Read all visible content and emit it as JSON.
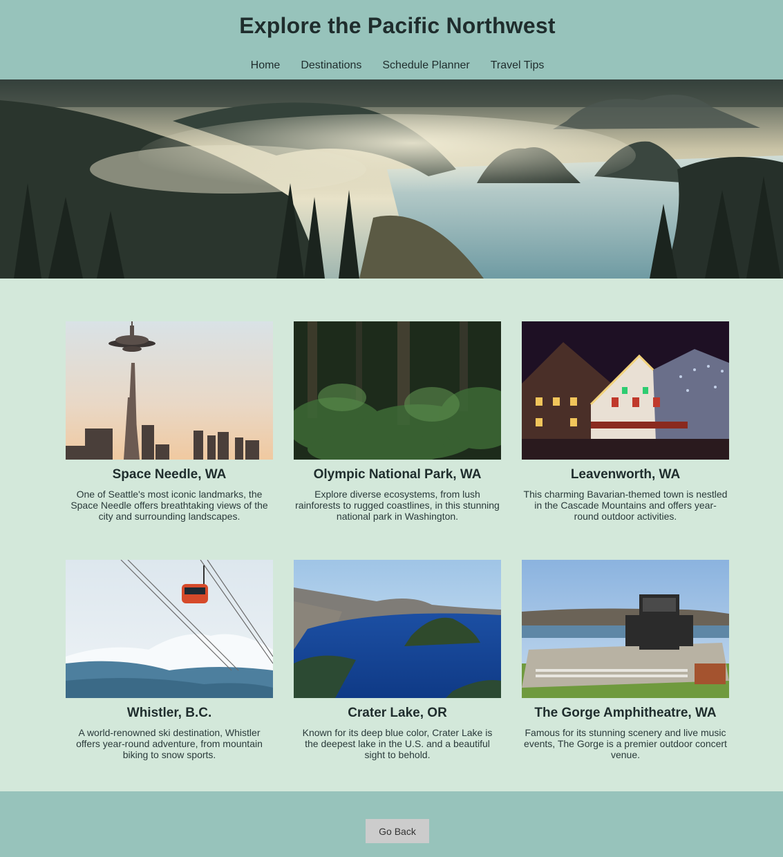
{
  "header": {
    "title": "Explore the Pacific Northwest",
    "nav": [
      "Home",
      "Destinations",
      "Schedule Planner",
      "Travel Tips"
    ]
  },
  "hero": {
    "image": "misty-coastal-forest-photo"
  },
  "destinations": [
    {
      "title": "Space Needle, WA",
      "description": "One of Seattle's most iconic landmarks, the Space Needle offers breathtaking views of the city and surrounding landscapes.",
      "image": "space-needle-photo"
    },
    {
      "title": "Olympic National Park, WA",
      "description": "Explore diverse ecosystems, from lush rainforests to rugged coastlines, in this stunning national park in Washington.",
      "image": "rainforest-photo"
    },
    {
      "title": "Leavenworth, WA",
      "description": "This charming Bavarian-themed town is nestled in the Cascade Mountains and offers year-round outdoor activities.",
      "image": "bavarian-town-photo"
    },
    {
      "title": "Whistler, B.C.",
      "description": "A world-renowned ski destination, Whistler offers year-round adventure, from mountain biking to snow sports.",
      "image": "gondola-photo"
    },
    {
      "title": "Crater Lake, OR",
      "description": "Known for its deep blue color, Crater Lake is the deepest lake in the U.S. and a beautiful sight to behold.",
      "image": "crater-lake-photo"
    },
    {
      "title": "The Gorge Amphitheatre, WA",
      "description": "Famous for its stunning scenery and live music events, The Gorge is a premier outdoor concert venue.",
      "image": "amphitheatre-photo"
    }
  ],
  "footer": {
    "back_label": "Go Back"
  },
  "colors": {
    "header_bg": "#97c3bb",
    "page_bg": "#d3e8da",
    "text": "#1f2d2d",
    "button_bg": "#cccccc"
  }
}
